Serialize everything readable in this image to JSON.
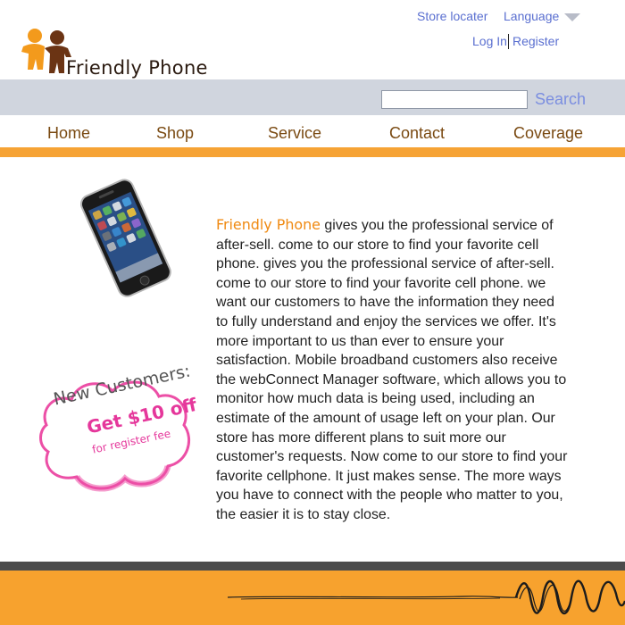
{
  "brand": {
    "name": "Friendly Phone"
  },
  "top_links": {
    "store_locator": "Store locater",
    "language": "Language",
    "login": "Log In",
    "register": "Register"
  },
  "search": {
    "value": "",
    "placeholder": "",
    "button_label": "Search"
  },
  "nav": {
    "items": [
      {
        "label": "Home"
      },
      {
        "label": "Shop"
      },
      {
        "label": "Service"
      },
      {
        "label": "Contact"
      },
      {
        "label": "Coverage"
      }
    ]
  },
  "promo": {
    "line1": "New Customers:",
    "line2": "Get $10 off",
    "line3": "for register fee"
  },
  "content": {
    "brand_inline": "Friendly Phone",
    "paragraph": " gives you the professional service of after-sell. come to our store to find your favorite cell phone. gives you the professional service of after-sell. come to our store to find your favorite cell phone. we want our customers to have the information they need to fully understand and enjoy the services we offer.  It's more important to us than ever to ensure your satisfaction.  Mobile broadband customers also receive the webConnect Manager software, which allows you to monitor how much data is being used, including an estimate of the amount of usage left on your plan. Our store has more different plans to suit more our customer's requests. Now come to our store to find your favorite cellphone. It just makes sense. The more ways you have to connect with the people who matter to you, the easier it is to stay close."
  },
  "colors": {
    "accent_orange": "#f6a335",
    "nav_text": "#7a4a12",
    "link_blue": "#5a6fd0",
    "search_band": "#d0d5de",
    "promo_pink": "#e5379b"
  }
}
